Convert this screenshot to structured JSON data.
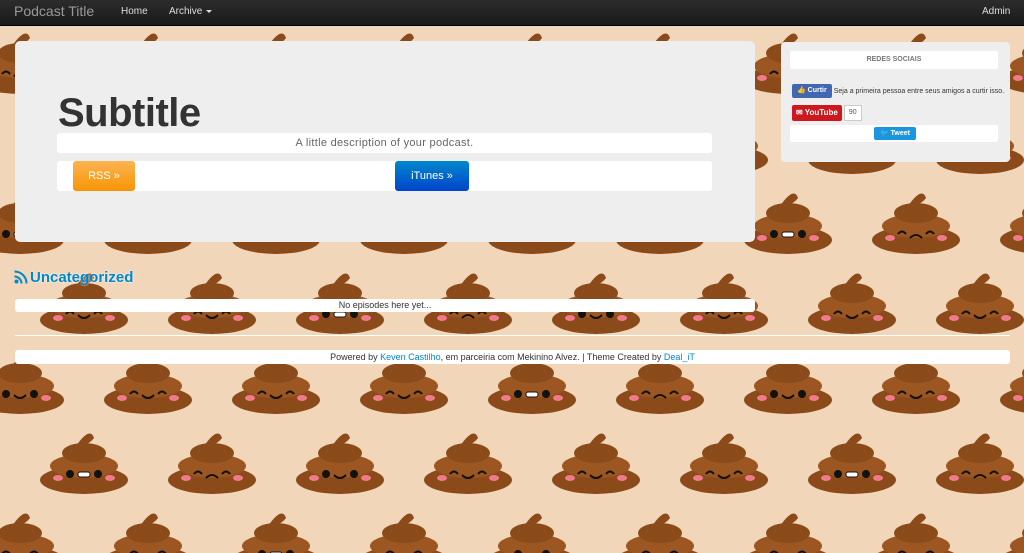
{
  "navbar": {
    "brand": "Podcast Title",
    "home": "Home",
    "archive": "Archive",
    "admin": "Admin"
  },
  "hero": {
    "title": "Subtitle",
    "description": "A little description of your podcast.",
    "rss_button": "RSS »",
    "itunes_button": "iTunes »"
  },
  "sidebar": {
    "heading": "REDES SOCIAIS",
    "facebook_button": "Curtir",
    "facebook_text": "Seja a primeira pessoa entre seus amigos a curtir isso.",
    "youtube_button": "YouTube",
    "youtube_count": "90",
    "tweet_button": "Tweet"
  },
  "category": {
    "title": "Uncategorized",
    "empty_text": "No episodes here yet..."
  },
  "footer": {
    "powered_by": "Powered by ",
    "author_link": "Keven Castilho",
    "partnership": ", em parceiria com Mekinino Alvez. | Theme Created by ",
    "theme_link": "Deal_iT"
  },
  "colors": {
    "background": "#f1d6ba",
    "poop": "#8a4a1a",
    "link": "#0088cc",
    "rss_button": "#f89406",
    "itunes_button": "#0044cc"
  }
}
